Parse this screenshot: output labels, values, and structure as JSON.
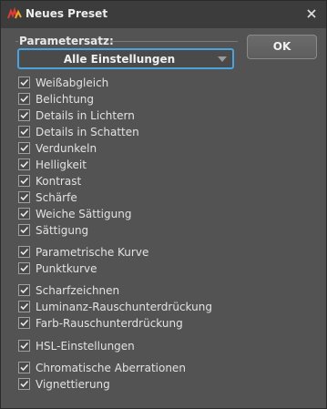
{
  "window": {
    "title": "Neues Preset"
  },
  "group": {
    "label": "Parametersatz:"
  },
  "select": {
    "value": "Alle Einstellungen"
  },
  "ok_button": {
    "label": "OK"
  },
  "checkboxes": [
    {
      "label": "Weißabgleich",
      "checked": true
    },
    {
      "label": "Belichtung",
      "checked": true
    },
    {
      "label": "Details in Lichtern",
      "checked": true
    },
    {
      "label": "Details in Schatten",
      "checked": true
    },
    {
      "label": "Verdunkeln",
      "checked": true
    },
    {
      "label": "Helligkeit",
      "checked": true
    },
    {
      "label": "Kontrast",
      "checked": true
    },
    {
      "label": "Schärfe",
      "checked": true
    },
    {
      "label": "Weiche Sättigung",
      "checked": true
    },
    {
      "label": "Sättigung",
      "checked": true
    },
    {
      "label": "Parametrische Kurve",
      "checked": true
    },
    {
      "label": "Punktkurve",
      "checked": true
    },
    {
      "label": "Scharfzeichnen",
      "checked": true
    },
    {
      "label": "Luminanz-Rauschunterdrückung",
      "checked": true
    },
    {
      "label": "Farb-Rauschunterdrückung",
      "checked": true
    },
    {
      "label": "HSL-Einstellungen",
      "checked": true
    },
    {
      "label": "Chromatische Aberrationen",
      "checked": true
    },
    {
      "label": "Vignettierung",
      "checked": true
    }
  ]
}
